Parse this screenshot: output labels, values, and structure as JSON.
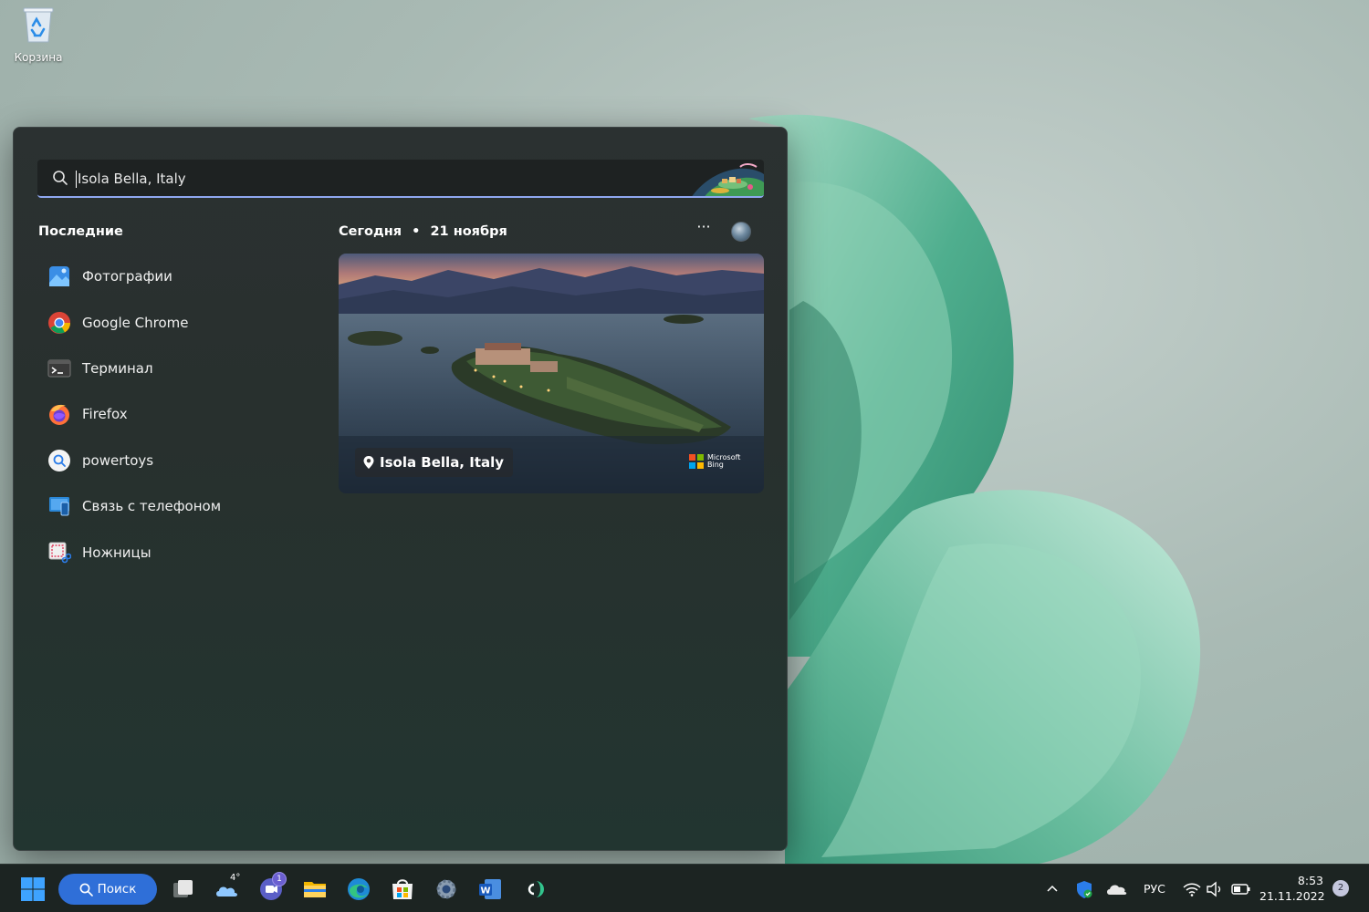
{
  "desktop": {
    "recycle_bin_label": "Корзина"
  },
  "search": {
    "query": "Isola Bella, Italy"
  },
  "recent": {
    "title": "Последние",
    "items": [
      {
        "label": "Фотографии",
        "icon": "photos-icon"
      },
      {
        "label": "Google Chrome",
        "icon": "chrome-icon"
      },
      {
        "label": "Терминал",
        "icon": "terminal-icon"
      },
      {
        "label": "Firefox",
        "icon": "firefox-icon"
      },
      {
        "label": "powertoys",
        "icon": "powertoys-icon"
      },
      {
        "label": "Связь с телефоном",
        "icon": "phone-link-icon"
      },
      {
        "label": "Ножницы",
        "icon": "snipping-tool-icon"
      }
    ]
  },
  "today": {
    "label": "Сегодня",
    "separator": "•",
    "date": "21 ноября",
    "more": "···",
    "hero_location": "Isola Bella, Italy",
    "bing_line1": "Microsoft",
    "bing_line2": "Bing"
  },
  "taskbar": {
    "search_label": "Поиск",
    "weather_temp": "4°",
    "chat_badge": "1",
    "language": "РУС",
    "time": "8:53",
    "date": "21.11.2022",
    "notifications": "2"
  },
  "colors": {
    "accent": "#2f6fd8",
    "panel": "#2b3131",
    "search_underline": "#8fa7f0"
  }
}
